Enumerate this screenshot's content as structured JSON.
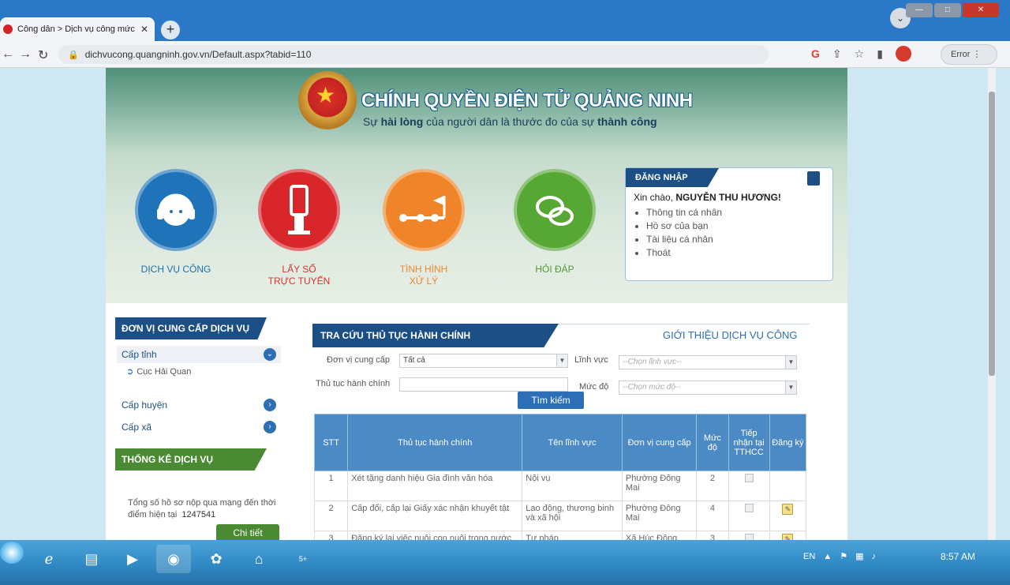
{
  "browser": {
    "tab_title": "Công dân > Dịch vụ công mức đ",
    "tab_close": "✕",
    "new_tab": "+",
    "url": "dichvucong.quangninh.gov.vn/Default.aspx?tabid=110",
    "error_label": "Error",
    "window_controls": {
      "minimize": "—",
      "maximize": "□",
      "close": "✕"
    }
  },
  "site": {
    "title": "CHÍNH QUYỀN ĐIỆN TỬ QUẢNG NINH",
    "slogan_parts": [
      "Sự ",
      "hài lòng",
      " của người dân là thước đo của sự ",
      "thành công"
    ]
  },
  "services": [
    {
      "label": "DỊCH VỤ CÔNG",
      "color": "#1e73b9",
      "label_color": "#1c6fa8"
    },
    {
      "label": "LẤY SỐ\nTRỰC TUYẾN",
      "color": "#d8262a",
      "label_color": "#d9332a"
    },
    {
      "label": "TÌNH HÌNH\nXỬ LÝ",
      "color": "#f08428",
      "label_color": "#f0862b"
    },
    {
      "label": "HỎI ĐÁP",
      "color": "#57a735",
      "label_color": "#4e9b33"
    }
  ],
  "login": {
    "header": "ĐĂNG NHẬP",
    "greeting": "Xin chào, ",
    "user_name": "NGUYỄN THU HƯƠNG!",
    "links": [
      "Thông tin cá nhân",
      "Hồ sơ của bạn",
      "Tài liệu cá nhân",
      "Thoát"
    ]
  },
  "sidebar": {
    "providers_header": "ĐƠN VỊ CUNG CẤP DỊCH VỤ",
    "levels": [
      {
        "label": "Cấp tỉnh",
        "expanded": true
      },
      {
        "label": "Cấp huyện",
        "expanded": false
      },
      {
        "label": "Cấp xã",
        "expanded": false
      }
    ],
    "sub_items": [
      "Cục Hải Quan"
    ],
    "stats_header": "THỐNG KÊ DỊCH VỤ",
    "stats_text": "Tổng số hồ sơ nộp qua mạng đến thời điểm hiện tại",
    "stats_value": "1247541",
    "detail_button": "Chi tiết"
  },
  "search": {
    "header": "TRA CỨU THỦ TỤC HÀNH CHÍNH",
    "intro_link": "GIỚI THIỆU DỊCH VỤ CÔNG",
    "provider_label": "Đơn vị cung cấp",
    "provider_value": "Tất cả",
    "field_label": "Lĩnh vực",
    "field_placeholder": "--Chọn lĩnh vực--",
    "procedure_label": "Thủ tục hành chính",
    "procedure_value": "",
    "level_label": "Mức độ",
    "level_placeholder": "--Chọn mức độ--",
    "search_button": "Tìm kiếm"
  },
  "table": {
    "headers": [
      "STT",
      "Thủ tục hành chính",
      "Tên lĩnh vực",
      "Đơn vị cung cấp",
      "Mức độ",
      "Tiếp nhận tại TTHCC",
      "Đăng ký"
    ],
    "rows": [
      {
        "stt": "1",
        "name": "Xét tặng danh hiệu Gia đình văn hóa",
        "field": "Nội vụ",
        "unit": "Phường Đông Mai",
        "level": "2",
        "register": false
      },
      {
        "stt": "2",
        "name": "Cấp đổi, cấp lại Giấy xác nhận khuyết tật",
        "field": "Lao động, thương binh và xã hội",
        "unit": "Phường Đông Mai",
        "level": "4",
        "register": true
      },
      {
        "stt": "3",
        "name": "Đăng ký lại việc nuôi con nuôi trong nước",
        "field": "Tư pháp",
        "unit": "Xã Húc Động",
        "level": "3",
        "register": true
      }
    ]
  },
  "taskbar": {
    "language": "EN",
    "time": "8:57 AM",
    "apps": [
      "windows-start",
      "internet-explorer",
      "file-explorer",
      "media-player",
      "chrome",
      "app-green",
      "app-house",
      "zalo"
    ],
    "zalo_badge": "5+"
  }
}
